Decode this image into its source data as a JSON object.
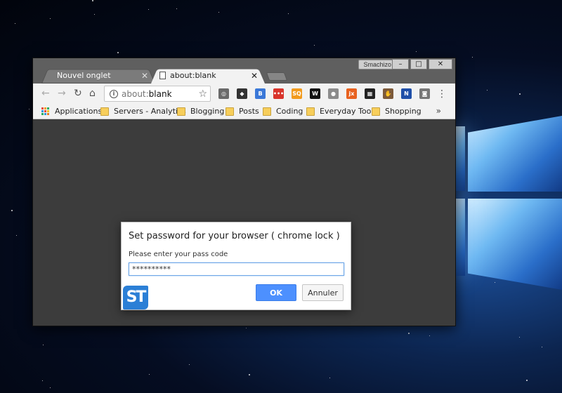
{
  "window": {
    "user_name": "Smachizo",
    "controls": {
      "minimize": "–",
      "maximize": "□",
      "close": "✕"
    }
  },
  "tabs": [
    {
      "label": "Nouvel onglet",
      "active": false
    },
    {
      "label": "about:blank",
      "active": true
    }
  ],
  "omnibox": {
    "scheme": "about:",
    "rest": "blank"
  },
  "bookmarks": {
    "apps_label": "Applications",
    "items": [
      "Servers - Analytics",
      "Blogging",
      "Posts",
      "Coding",
      "Everyday Tools",
      "Shopping"
    ],
    "more": "»"
  },
  "extensions": [
    {
      "name": "reader-extension-icon",
      "glyph": "◎",
      "color": "#6a6a6a"
    },
    {
      "name": "ghost-extension-icon",
      "glyph": "◆",
      "color": "#333333"
    },
    {
      "name": "b-extension-icon",
      "glyph": "B",
      "color": "#3a78d8"
    },
    {
      "name": "red-extension-icon",
      "glyph": "•••",
      "color": "#d9342b"
    },
    {
      "name": "seo-quake-icon",
      "glyph": "SQ",
      "color": "#f29b1d"
    },
    {
      "name": "w-extension-icon",
      "glyph": "W",
      "color": "#111111"
    },
    {
      "name": "globe-extension-icon",
      "glyph": "●",
      "color": "#8c8c8c"
    },
    {
      "name": "jx-extension-icon",
      "glyph": "jx",
      "color": "#e8611f"
    },
    {
      "name": "qr-extension-icon",
      "glyph": "▦",
      "color": "#222222"
    },
    {
      "name": "hand-extension-icon",
      "glyph": "✋",
      "color": "#7d5a3a"
    },
    {
      "name": "n-extension-icon",
      "glyph": "N",
      "color": "#1f4fa8"
    },
    {
      "name": "camera-extension-icon",
      "glyph": "◙",
      "color": "#777777"
    }
  ],
  "dialog": {
    "title": "Set password for your browser ( chrome lock )",
    "label": "Please enter your pass code",
    "input_value": "**********",
    "ok_label": "OK",
    "cancel_label": "Annuler",
    "logo_text": "ST"
  },
  "colors": {
    "accent": "#4d90fe",
    "logo": "#2b7fd6"
  }
}
